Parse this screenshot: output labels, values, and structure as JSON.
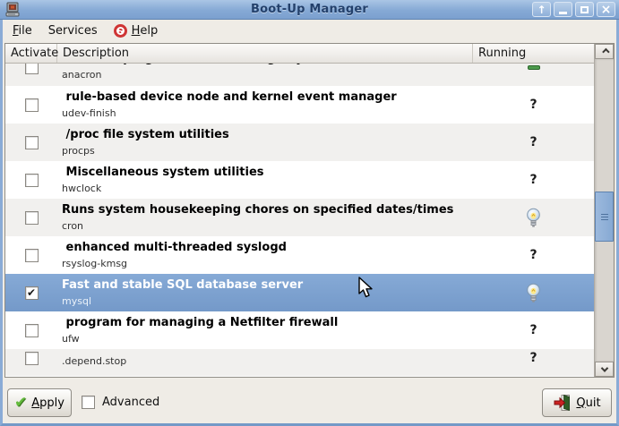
{
  "window": {
    "title": "Boot-Up Manager"
  },
  "menubar": {
    "file": {
      "mnemonic": "F",
      "rest": "ile"
    },
    "services": {
      "mnemonic": "",
      "rest": "Services"
    },
    "help": {
      "mnemonic": "H",
      "rest": "elp"
    }
  },
  "table": {
    "columns": [
      "Activate",
      "Description",
      "Running"
    ],
    "rows": [
      {
        "name": "anacron",
        "description": "cron-like program that doesn't go by time",
        "checked": false,
        "running": "running",
        "partial": "top"
      },
      {
        "name": "udev-finish",
        "description": " rule-based device node and kernel event manager",
        "checked": false,
        "running": "unknown"
      },
      {
        "name": "procps",
        "description": " /proc file system utilities",
        "checked": false,
        "running": "unknown"
      },
      {
        "name": "hwclock",
        "description": " Miscellaneous system utilities",
        "checked": false,
        "running": "unknown"
      },
      {
        "name": "cron",
        "description": "Runs system housekeeping chores on specified dates/times",
        "checked": false,
        "running": "running"
      },
      {
        "name": "rsyslog-kmsg",
        "description": " enhanced multi-threaded syslogd",
        "checked": false,
        "running": "unknown"
      },
      {
        "name": "mysql",
        "description": "Fast and stable SQL database server",
        "checked": true,
        "running": "running",
        "selected": true
      },
      {
        "name": "ufw",
        "description": " program for managing a Netfilter firewall",
        "checked": false,
        "running": "unknown"
      },
      {
        "name": ".depend.stop",
        "description": "",
        "checked": false,
        "running": "unknown",
        "partial": "bottom"
      }
    ]
  },
  "icons": {
    "unknown_status": "?",
    "checkbox_check": "✔",
    "shade_arrow": "↑",
    "close_x": "×"
  },
  "footer": {
    "apply": {
      "mnemonic": "A",
      "rest": "pply"
    },
    "advanced_label": "Advanced",
    "quit": {
      "mnemonic": "Q",
      "rest": "uit"
    }
  },
  "colors": {
    "titlebar_blue": "#85a9d5",
    "selection_blue": "#7aa0cf",
    "row_alt_gray": "#f1f0ee",
    "running_green": "#4d9b4d",
    "apply_check_green": "#63bb3c",
    "quit_arrow_red": "#cc2222"
  }
}
